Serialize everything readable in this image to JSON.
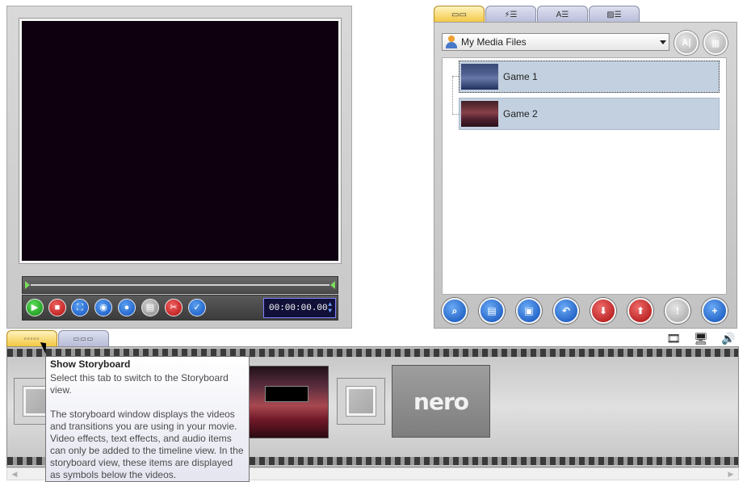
{
  "preview": {
    "timecode": "00:00:00.00",
    "transport": {
      "play": "▶",
      "stop": "■",
      "fullscreen": "⛶",
      "snapshot": "◉",
      "record": "●",
      "film": "▤",
      "cut": "✂",
      "check": "✓"
    }
  },
  "media": {
    "tabs": [
      "▭▭",
      "⚡☰",
      "A☰",
      "▨☰"
    ],
    "source": "My Media Files",
    "items": [
      {
        "label": "Game 1"
      },
      {
        "label": "Game 2"
      }
    ],
    "round_buttons": {
      "a": "A|",
      "b": "▦"
    }
  },
  "view_tabs": [
    "▫▫▫▫▫",
    "▭▭▭"
  ],
  "audio_tools": {
    "video": "🎞",
    "monitor": "🖥",
    "volume": "🔊"
  },
  "storyboard": {
    "nero_label": "nero"
  },
  "tooltip": {
    "title": "Show Storyboard",
    "line1": "Select this tab to switch to the Storyboard view.",
    "line2": "The storyboard window displays the videos and transitions you are using in your movie. Video effects, text effects, and audio items can only be added to the timeline view. In the storyboard view, these items are displayed as symbols below the videos."
  },
  "scroll": {
    "left": "◀",
    "right": "▶"
  },
  "colors": {
    "preview_black": "#0f000f",
    "tab_active": "#f2c640",
    "item_bg": "#c2d0df",
    "tooltip_bg": "#e4e5f0"
  }
}
